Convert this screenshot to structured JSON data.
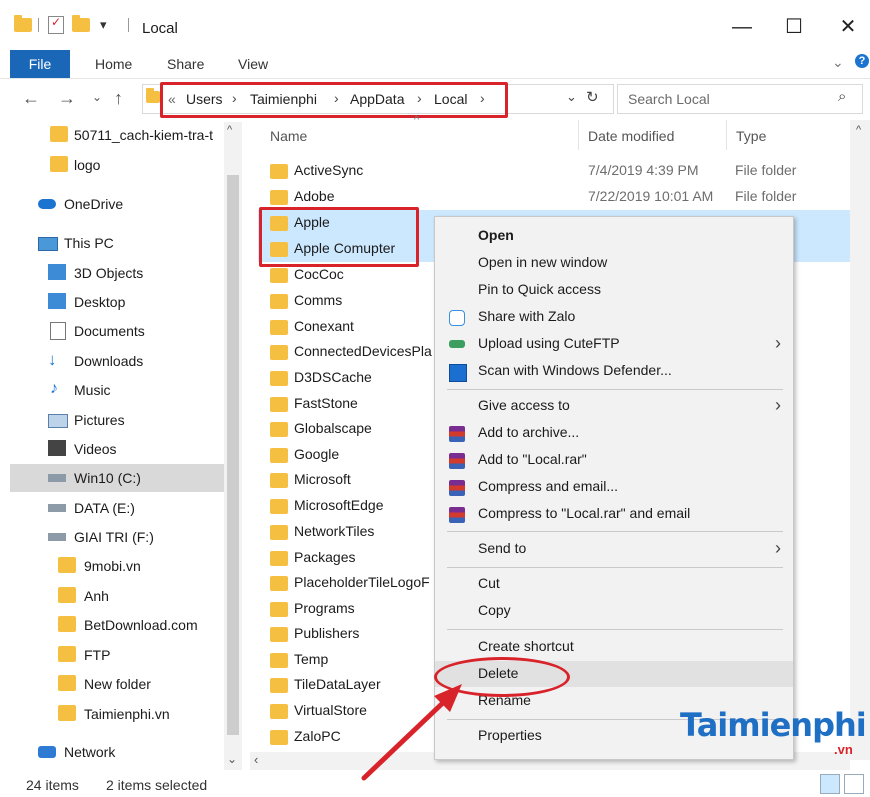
{
  "window": {
    "title": "Local",
    "controls": {
      "minimize": "—",
      "maximize": "☐",
      "close": "✕"
    }
  },
  "ribbon": {
    "tabs": [
      "File",
      "Home",
      "Share",
      "View"
    ]
  },
  "address": {
    "overflow": "«",
    "breadcrumbs": [
      "Users",
      "Taimienphi",
      "AppData",
      "Local"
    ],
    "search_placeholder": "Search Local"
  },
  "nav_pane": {
    "items": [
      {
        "label": "50711_cach-kiem-tra-t",
        "icon": "folder-icon"
      },
      {
        "label": "logo",
        "icon": "folder-icon"
      },
      {
        "label": "OneDrive",
        "icon": "onedrive-icon"
      },
      {
        "label": "This PC",
        "icon": "computer-icon"
      },
      {
        "label": "3D Objects",
        "icon": "3d-objects-icon"
      },
      {
        "label": "Desktop",
        "icon": "desktop-icon"
      },
      {
        "label": "Documents",
        "icon": "documents-icon"
      },
      {
        "label": "Downloads",
        "icon": "downloads-icon"
      },
      {
        "label": "Music",
        "icon": "music-icon"
      },
      {
        "label": "Pictures",
        "icon": "pictures-icon"
      },
      {
        "label": "Videos",
        "icon": "videos-icon"
      },
      {
        "label": "Win10 (C:)",
        "icon": "drive-icon"
      },
      {
        "label": "DATA (E:)",
        "icon": "drive-icon"
      },
      {
        "label": "GIAI TRI (F:)",
        "icon": "drive-icon"
      },
      {
        "label": "9mobi.vn",
        "icon": "folder-icon"
      },
      {
        "label": "Anh",
        "icon": "folder-icon"
      },
      {
        "label": "BetDownload.com",
        "icon": "folder-icon"
      },
      {
        "label": "FTP",
        "icon": "folder-icon"
      },
      {
        "label": "New folder",
        "icon": "folder-icon"
      },
      {
        "label": "Taimienphi.vn",
        "icon": "folder-icon"
      },
      {
        "label": "Network",
        "icon": "network-icon"
      }
    ],
    "selected": "Win10 (C:)"
  },
  "columns": {
    "name": "Name",
    "date": "Date modified",
    "type": "Type"
  },
  "files": [
    {
      "name": "ActiveSync",
      "date": "7/4/2019 4:39 PM",
      "type": "File folder"
    },
    {
      "name": "Adobe",
      "date": "7/22/2019 10:01 AM",
      "type": "File folder"
    },
    {
      "name": "Apple",
      "date": "",
      "type": ""
    },
    {
      "name": "Apple Comupter",
      "date": "",
      "type": ""
    },
    {
      "name": "CocCoc",
      "date": "",
      "type": ""
    },
    {
      "name": "Comms",
      "date": "",
      "type": ""
    },
    {
      "name": "Conexant",
      "date": "",
      "type": ""
    },
    {
      "name": "ConnectedDevicesPla",
      "date": "",
      "type": ""
    },
    {
      "name": "D3DSCache",
      "date": "",
      "type": ""
    },
    {
      "name": "FastStone",
      "date": "",
      "type": ""
    },
    {
      "name": "Globalscape",
      "date": "",
      "type": ""
    },
    {
      "name": "Google",
      "date": "",
      "type": ""
    },
    {
      "name": "Microsoft",
      "date": "",
      "type": ""
    },
    {
      "name": "MicrosoftEdge",
      "date": "",
      "type": ""
    },
    {
      "name": "NetworkTiles",
      "date": "",
      "type": ""
    },
    {
      "name": "Packages",
      "date": "",
      "type": ""
    },
    {
      "name": "PlaceholderTileLogoF",
      "date": "",
      "type": ""
    },
    {
      "name": "Programs",
      "date": "",
      "type": ""
    },
    {
      "name": "Publishers",
      "date": "",
      "type": ""
    },
    {
      "name": "Temp",
      "date": "",
      "type": ""
    },
    {
      "name": "TileDataLayer",
      "date": "",
      "type": ""
    },
    {
      "name": "VirtualStore",
      "date": "",
      "type": ""
    },
    {
      "name": "ZaloPC",
      "date": "",
      "type": ""
    }
  ],
  "context_menu": {
    "open": "Open",
    "open_new_window": "Open in new window",
    "pin_quick_access": "Pin to Quick access",
    "share_zalo": "Share with Zalo",
    "upload_cuteftp": "Upload using CuteFTP",
    "scan_defender": "Scan with Windows Defender...",
    "give_access": "Give access to",
    "add_archive": "Add to archive...",
    "add_local_rar": "Add to \"Local.rar\"",
    "compress_email": "Compress and email...",
    "compress_local_rar_email": "Compress to \"Local.rar\" and email",
    "send_to": "Send to",
    "cut": "Cut",
    "copy": "Copy",
    "create_shortcut": "Create shortcut",
    "delete": "Delete",
    "rename": "Rename",
    "properties": "Properties"
  },
  "status": {
    "items": "24 items",
    "selected": "2 items selected"
  },
  "logo": {
    "main": "Taimienphi",
    "suffix": ".vn"
  },
  "colors": {
    "accent": "#1a67b7",
    "selection": "#cce8ff",
    "annotation": "#d8232a"
  }
}
